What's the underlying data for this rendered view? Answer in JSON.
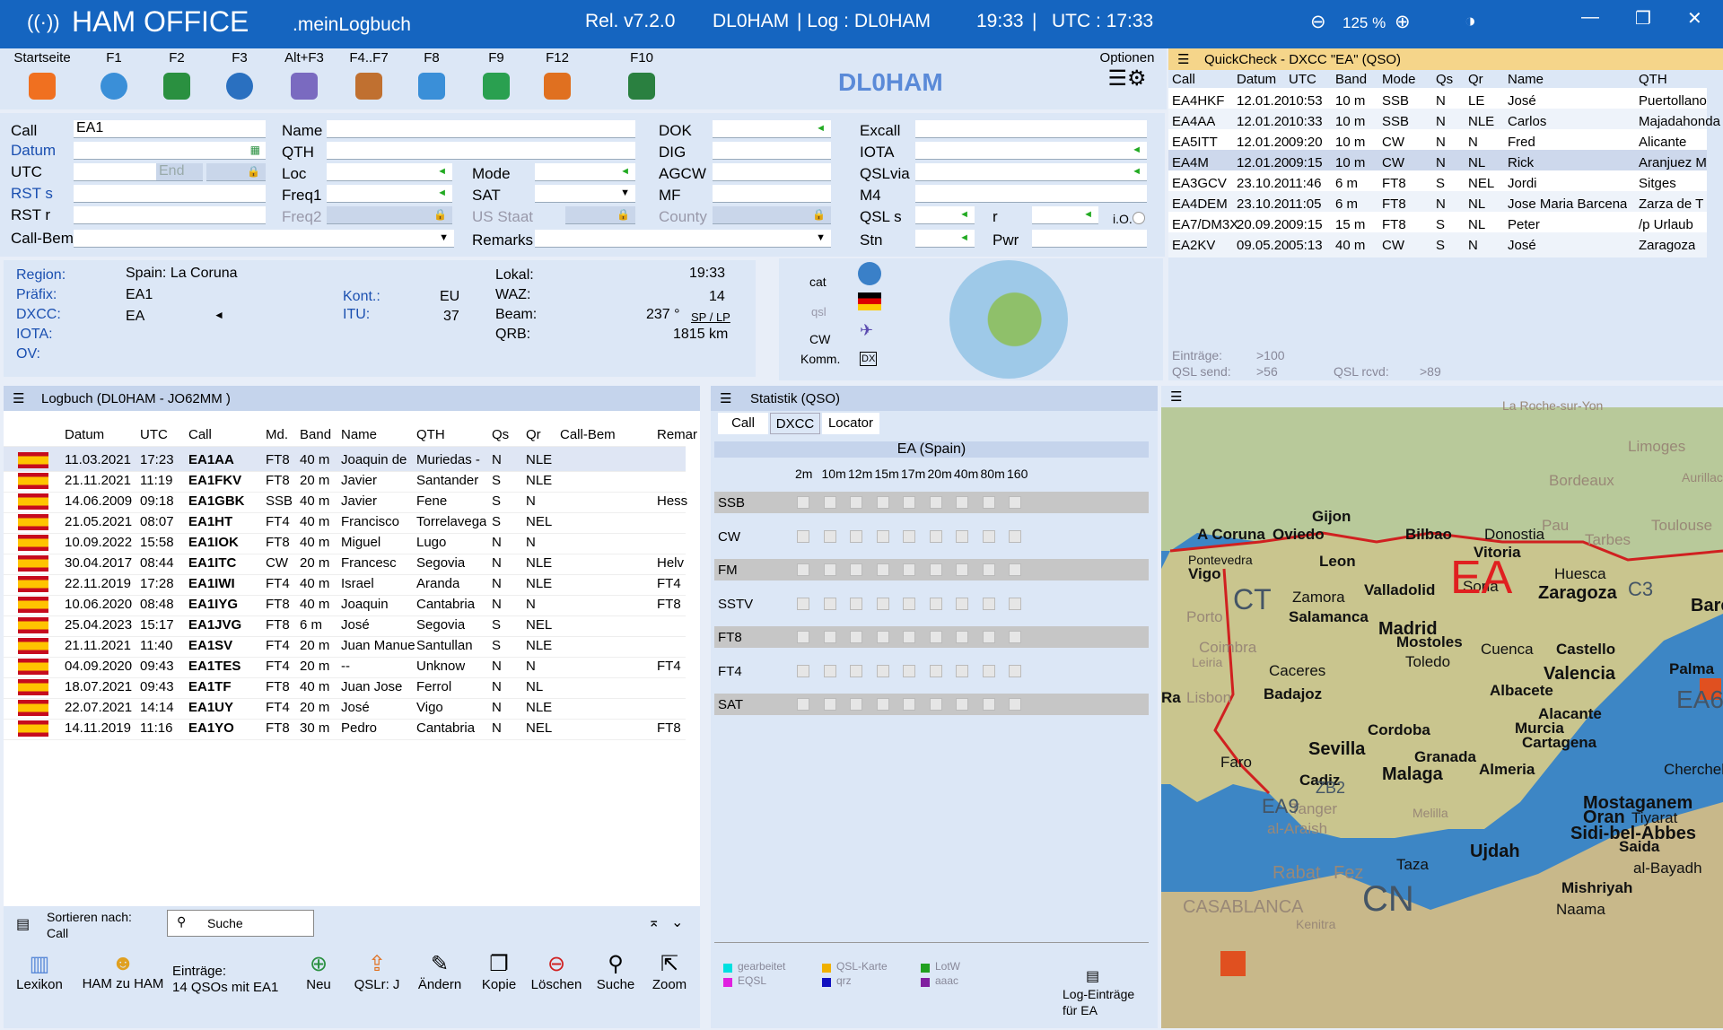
{
  "title": {
    "app": "HAM OFFICE",
    "sub": ".meinLogbuch",
    "rel": "Rel. v7.2.0",
    "call": "DL0HAM",
    "log": "|   Log : DL0HAM",
    "time": "19:33",
    "sep": "|",
    "utc": "UTC : 17:33",
    "zoom": "125 %"
  },
  "toolbar": [
    {
      "k": "Startseite",
      "c": "#f07020"
    },
    {
      "k": "F1",
      "c": "#3a8fd8"
    },
    {
      "k": "F2",
      "c": "#2a9040"
    },
    {
      "k": "F3",
      "c": "#2a70c0"
    },
    {
      "k": "Alt+F3",
      "c": "#7a6ac0"
    },
    {
      "k": "F4..F7",
      "c": "#c07030"
    },
    {
      "k": "F8",
      "c": "#3a8fd8"
    },
    {
      "k": "F9",
      "c": "#2aa050"
    },
    {
      "k": "F12",
      "c": "#e07020"
    },
    {
      "k": "F10",
      "c": "#2a8040"
    }
  ],
  "logo": "DL0HAM",
  "options": "Optionen",
  "form": {
    "call_l": "Call",
    "call": "EA1",
    "datum_l": "Datum",
    "utc_l": "UTC",
    "end": "End",
    "rsts_l": "RST s",
    "rstr_l": "RST r",
    "callbem_l": "Call-Bem.",
    "name_l": "Name",
    "qth_l": "QTH",
    "loc_l": "Loc",
    "freq1_l": "Freq1",
    "freq2_l": "Freq2",
    "mode_l": "Mode",
    "sat_l": "SAT",
    "usstaat": "US Staat",
    "remarks_l": "Remarks",
    "dok_l": "DOK",
    "dig_l": "DIG",
    "agcw_l": "AGCW",
    "mf_l": "MF",
    "county": "County",
    "excall_l": "Excall",
    "iota_l": "IOTA",
    "qslvia_l": "QSLvia",
    "m4_l": "M4",
    "qsls_l": "QSL s",
    "r_l": "r",
    "io": "i.O.",
    "stn_l": "Stn",
    "pwr_l": "Pwr"
  },
  "region": {
    "region_l": "Region:",
    "region": "Spain: La Coruna",
    "praefix_l": "Präfix:",
    "praefix": "EA1",
    "kont_l": "Kont.:",
    "kont": "EU",
    "dxcc_l": "DXCC:",
    "dxcc": "EA",
    "itu_l": "ITU:",
    "itu": "37",
    "iota_l": "IOTA:",
    "ov_l": "OV:",
    "lokal_l": "Lokal:",
    "lokal": "19:33",
    "waz_l": "WAZ:",
    "waz": "14",
    "beam_l": "Beam:",
    "beam": "237 °",
    "sp": "SP / LP",
    "qrb_l": "QRB:",
    "qrb": "1815   km",
    "cat": "cat",
    "qsl": "qsl",
    "cw": "CW",
    "komm": "Komm."
  },
  "quickcheck": {
    "title": "QuickCheck - DXCC \"EA\" (QSO)",
    "cols": [
      "Call",
      "Datum",
      "UTC",
      "Band",
      "Mode",
      "Qs",
      "Qr",
      "Name",
      "QTH"
    ],
    "rows": [
      [
        "EA4HKF",
        "12.01.20",
        "10:53",
        "10 m",
        "SSB",
        "N",
        "LE",
        "José",
        "Puertollano"
      ],
      [
        "EA4AA",
        "12.01.20",
        "10:33",
        "10 m",
        "SSB",
        "N",
        "NLE",
        "Carlos",
        "Majadahonda"
      ],
      [
        "EA5ITT",
        "12.01.20",
        "09:20",
        "10 m",
        "CW",
        "N",
        "N",
        "Fred",
        "Alicante"
      ],
      [
        "EA4M",
        "12.01.20",
        "09:15",
        "10 m",
        "CW",
        "N",
        "NL",
        "Rick",
        "Aranjuez M"
      ],
      [
        "EA3GCV",
        "23.10.20",
        "11:46",
        "6 m",
        "FT8",
        "S",
        "NEL",
        "Jordi",
        "Sitges"
      ],
      [
        "EA4DEM",
        "23.10.20",
        "11:05",
        "6 m",
        "FT8",
        "N",
        "NL",
        "Jose Maria Barcena",
        "Zarza de T"
      ],
      [
        "EA7/DM3X",
        "20.09.20",
        "09:15",
        "15 m",
        "FT8",
        "S",
        "NL",
        "Peter",
        "/p Urlaub"
      ],
      [
        "EA2KV",
        "09.05.20",
        "05:13",
        "40 m",
        "CW",
        "S",
        "N",
        "José",
        "Zaragoza"
      ]
    ],
    "eintraege_l": "Einträge:",
    "eintraege": ">100",
    "qslsend_l": "QSL send:",
    "qslsend": ">56",
    "qslrcvd_l": "QSL rcvd:",
    "qslrcvd": ">89"
  },
  "log": {
    "title": "Logbuch  (DL0HAM - JO62MM )",
    "cols": [
      "Datum",
      "UTC",
      "Call",
      "Md.",
      "Band",
      "Name",
      "QTH",
      "Qs",
      "Qr",
      "Call-Bem",
      "Remar"
    ],
    "rows": [
      [
        "11.03.2021",
        "17:23",
        "EA1AA",
        "FT8",
        "40 m",
        "Joaquin de",
        "Muriedas -",
        "N",
        "NLE",
        ""
      ],
      [
        "21.11.2021",
        "11:19",
        "EA1FKV",
        "FT8",
        "20 m",
        "Javier",
        "Santander",
        "S",
        "NLE",
        ""
      ],
      [
        "14.06.2009",
        "09:18",
        "EA1GBK",
        "SSB",
        "40 m",
        "Javier",
        "Fene",
        "S",
        "N",
        "Hess"
      ],
      [
        "21.05.2021",
        "08:07",
        "EA1HT",
        "FT4",
        "40 m",
        "Francisco",
        "Torrelavega",
        "S",
        "NEL",
        ""
      ],
      [
        "10.09.2022",
        "15:58",
        "EA1IOK",
        "FT8",
        "40 m",
        "Miguel",
        "Lugo",
        "N",
        "N",
        ""
      ],
      [
        "30.04.2017",
        "08:44",
        "EA1ITC",
        "CW",
        "20 m",
        "Francesc",
        "Segovia",
        "N",
        "NLE",
        "Helv"
      ],
      [
        "22.11.2019",
        "17:28",
        "EA1IWI",
        "FT4",
        "40 m",
        "Israel",
        "Aranda",
        "N",
        "NLE",
        "FT4"
      ],
      [
        "10.06.2020",
        "08:48",
        "EA1IYG",
        "FT8",
        "40 m",
        "Joaquin",
        "Cantabria",
        "N",
        "N",
        "FT8"
      ],
      [
        "25.04.2023",
        "15:17",
        "EA1JVG",
        "FT8",
        "6 m",
        "José",
        "Segovia",
        "S",
        "NEL",
        ""
      ],
      [
        "21.11.2021",
        "11:40",
        "EA1SV",
        "FT4",
        "20 m",
        "Juan Manue",
        "Santullan",
        "S",
        "NLE",
        ""
      ],
      [
        "04.09.2020",
        "09:43",
        "EA1TES",
        "FT4",
        "20 m",
        "--",
        "Unknow",
        "N",
        "N",
        "FT4"
      ],
      [
        "18.07.2021",
        "09:43",
        "EA1TF",
        "FT8",
        "40 m",
        "Juan Jose",
        "Ferrol",
        "N",
        "NL",
        ""
      ],
      [
        "22.07.2021",
        "14:14",
        "EA1UY",
        "FT4",
        "20 m",
        "José",
        "Vigo",
        "N",
        "NLE",
        ""
      ],
      [
        "14.11.2019",
        "11:16",
        "EA1YO",
        "FT8",
        "30 m",
        "Pedro",
        "Cantabria",
        "N",
        "NEL",
        "FT8"
      ]
    ],
    "sort_l": "Sortieren nach:",
    "sort": "Call",
    "suche": "Suche",
    "bottom": [
      "Lexikon",
      "HAM zu HAM",
      "Neu",
      "QSLr: J",
      "Ändern",
      "Kopie",
      "Löschen",
      "Suche",
      "Zoom"
    ],
    "eintraege_l": "Einträge:",
    "eintraege": "14 QSOs mit EA1"
  },
  "stat": {
    "title": "Statistik (QSO)",
    "tabs": [
      "Call",
      "DXCC",
      "Locator"
    ],
    "country": "EA (Spain)",
    "bands": [
      "2m",
      "10m",
      "12m",
      "15m",
      "17m",
      "20m",
      "40m",
      "80m",
      "160"
    ],
    "modes": [
      "SSB",
      "CW",
      "FM",
      "SSTV",
      "FT8",
      "FT4",
      "SAT"
    ],
    "legend": [
      "gearbeitet",
      "QSL-Karte",
      "LotW",
      "EQSL",
      "qrz",
      "aaac"
    ],
    "log_eintraege": "Log-Einträge",
    "fuer": "für EA"
  },
  "map": {
    "country": "EA",
    "cities": [
      "A Coruna",
      "Oviedo",
      "Gijon",
      "Bilbao",
      "Donostia",
      "Vitoria",
      "Leon",
      "Vigo",
      "Pontevedra",
      "Valladolid",
      "Soria",
      "Zaragoza",
      "Zamora",
      "Salamanca",
      "Madrid",
      "Mostoles",
      "Cuenca",
      "Toledo",
      "Castello",
      "Valencia",
      "Caceres",
      "Badajoz",
      "Albacete",
      "Alacante",
      "Murcia",
      "Cartagena",
      "Cordoba",
      "Sevilla",
      "Granada",
      "Almeria",
      "Malaga",
      "Cadiz",
      "Huesca",
      "Barc",
      "Palma",
      "EA6",
      "Faro",
      "Ujdah",
      "Mostaganem",
      "Oran",
      "Sidi-bel-Abbes",
      "Taza",
      "Tanger",
      "Fez",
      "CN",
      "EA9",
      "ZB2",
      "C3",
      "CT",
      "CASABLANCA",
      "Chercheli",
      "Saida",
      "Tiyarat",
      "Mishriyah",
      "Naama",
      "al-Bayadh",
      "Limoges",
      "Bordeaux",
      "Toulouse",
      "Tarbes",
      "Pau",
      "Porto",
      "Coimbra",
      "Lisbon",
      "al-Araish",
      "Melilla",
      "Rabat",
      "Aurillac",
      "Leiria",
      "Kenitra",
      "La Roche-sur-Yon",
      "Ra"
    ]
  }
}
